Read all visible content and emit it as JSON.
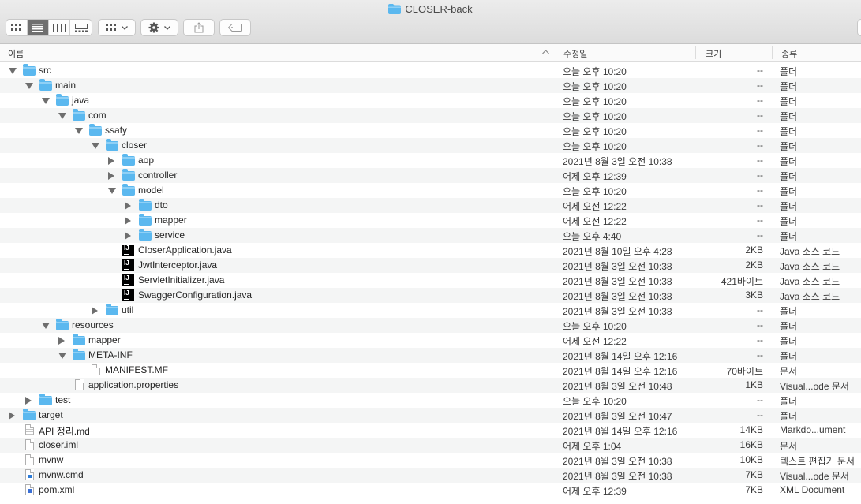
{
  "window": {
    "title": "CLOSER-back"
  },
  "toolbar": {
    "view_modes": [
      "icon-view",
      "list-view",
      "column-view",
      "gallery-view"
    ],
    "active_view": 1
  },
  "columns": {
    "name": "이름",
    "date": "수정일",
    "size": "크기",
    "kind": "종류"
  },
  "rows": [
    {
      "name": "src",
      "date": "오늘 오후 10:20",
      "size": "--",
      "kind": "폴더",
      "level": 0,
      "disclosure": "open",
      "icon": "folder-icon"
    },
    {
      "name": "main",
      "date": "오늘 오후 10:20",
      "size": "--",
      "kind": "폴더",
      "level": 1,
      "disclosure": "open",
      "icon": "folder-icon"
    },
    {
      "name": "java",
      "date": "오늘 오후 10:20",
      "size": "--",
      "kind": "폴더",
      "level": 2,
      "disclosure": "open",
      "icon": "folder-icon"
    },
    {
      "name": "com",
      "date": "오늘 오후 10:20",
      "size": "--",
      "kind": "폴더",
      "level": 3,
      "disclosure": "open",
      "icon": "folder-icon"
    },
    {
      "name": "ssafy",
      "date": "오늘 오후 10:20",
      "size": "--",
      "kind": "폴더",
      "level": 4,
      "disclosure": "open",
      "icon": "folder-icon"
    },
    {
      "name": "closer",
      "date": "오늘 오후 10:20",
      "size": "--",
      "kind": "폴더",
      "level": 5,
      "disclosure": "open",
      "icon": "folder-icon"
    },
    {
      "name": "aop",
      "date": "2021년 8월 3일 오전 10:38",
      "size": "--",
      "kind": "폴더",
      "level": 6,
      "disclosure": "closed",
      "icon": "folder-icon"
    },
    {
      "name": "controller",
      "date": "어제 오후 12:39",
      "size": "--",
      "kind": "폴더",
      "level": 6,
      "disclosure": "closed",
      "icon": "folder-icon"
    },
    {
      "name": "model",
      "date": "오늘 오후 10:20",
      "size": "--",
      "kind": "폴더",
      "level": 6,
      "disclosure": "open",
      "icon": "folder-icon"
    },
    {
      "name": "dto",
      "date": "어제 오전 12:22",
      "size": "--",
      "kind": "폴더",
      "level": 7,
      "disclosure": "closed",
      "icon": "folder-icon"
    },
    {
      "name": "mapper",
      "date": "어제 오전 12:22",
      "size": "--",
      "kind": "폴더",
      "level": 7,
      "disclosure": "closed",
      "icon": "folder-icon"
    },
    {
      "name": "service",
      "date": "오늘 오후 4:40",
      "size": "--",
      "kind": "폴더",
      "level": 7,
      "disclosure": "closed",
      "icon": "folder-icon"
    },
    {
      "name": "CloserApplication.java",
      "date": "2021년 8월 10일 오후 4:28",
      "size": "2KB",
      "kind": "Java 소스 코드",
      "level": 6,
      "disclosure": "none",
      "icon": "intellij-java-icon"
    },
    {
      "name": "JwtInterceptor.java",
      "date": "2021년 8월 3일 오전 10:38",
      "size": "2KB",
      "kind": "Java 소스 코드",
      "level": 6,
      "disclosure": "none",
      "icon": "intellij-java-icon"
    },
    {
      "name": "ServletInitializer.java",
      "date": "2021년 8월 3일 오전 10:38",
      "size": "421바이트",
      "kind": "Java 소스 코드",
      "level": 6,
      "disclosure": "none",
      "icon": "intellij-java-icon"
    },
    {
      "name": "SwaggerConfiguration.java",
      "date": "2021년 8월 3일 오전 10:38",
      "size": "3KB",
      "kind": "Java 소스 코드",
      "level": 6,
      "disclosure": "none",
      "icon": "intellij-java-icon"
    },
    {
      "name": "util",
      "date": "2021년 8월 3일 오전 10:38",
      "size": "--",
      "kind": "폴더",
      "level": 5,
      "disclosure": "closed",
      "icon": "folder-icon"
    },
    {
      "name": "resources",
      "date": "오늘 오후 10:20",
      "size": "--",
      "kind": "폴더",
      "level": 2,
      "disclosure": "open",
      "icon": "folder-icon"
    },
    {
      "name": "mapper",
      "date": "어제 오전 12:22",
      "size": "--",
      "kind": "폴더",
      "level": 3,
      "disclosure": "closed",
      "icon": "folder-icon"
    },
    {
      "name": "META-INF",
      "date": "2021년 8월 14일 오후 12:16",
      "size": "--",
      "kind": "폴더",
      "level": 3,
      "disclosure": "open",
      "icon": "folder-icon"
    },
    {
      "name": "MANIFEST.MF",
      "date": "2021년 8월 14일 오후 12:16",
      "size": "70바이트",
      "kind": "문서",
      "level": 4,
      "disclosure": "none",
      "icon": "document-icon"
    },
    {
      "name": "application.properties",
      "date": "2021년 8월 3일 오전 10:48",
      "size": "1KB",
      "kind": "Visual...ode 문서",
      "level": 3,
      "disclosure": "none",
      "icon": "document-icon"
    },
    {
      "name": "test",
      "date": "오늘 오후 10:20",
      "size": "--",
      "kind": "폴더",
      "level": 1,
      "disclosure": "closed",
      "icon": "folder-icon"
    },
    {
      "name": "target",
      "date": "2021년 8월 3일 오전 10:47",
      "size": "--",
      "kind": "폴더",
      "level": 0,
      "disclosure": "closed",
      "icon": "folder-icon"
    },
    {
      "name": "API 정리.md",
      "date": "2021년 8월 14일 오후 12:16",
      "size": "14KB",
      "kind": "Markdo...ument",
      "level": 0,
      "disclosure": "none",
      "icon": "text-document-icon"
    },
    {
      "name": "closer.iml",
      "date": "어제 오후 1:04",
      "size": "16KB",
      "kind": "문서",
      "level": 0,
      "disclosure": "none",
      "icon": "document-icon"
    },
    {
      "name": "mvnw",
      "date": "2021년 8월 3일 오전 10:38",
      "size": "10KB",
      "kind": "텍스트 편집기 문서",
      "level": 0,
      "disclosure": "none",
      "icon": "document-icon"
    },
    {
      "name": "mvnw.cmd",
      "date": "2021년 8월 3일 오전 10:38",
      "size": "7KB",
      "kind": "Visual...ode 문서",
      "level": 0,
      "disclosure": "none",
      "icon": "cmd-document-icon"
    },
    {
      "name": "pom.xml",
      "date": "어제 오후 12:39",
      "size": "7KB",
      "kind": "XML Document",
      "level": 0,
      "disclosure": "none",
      "icon": "xml-document-icon"
    }
  ]
}
